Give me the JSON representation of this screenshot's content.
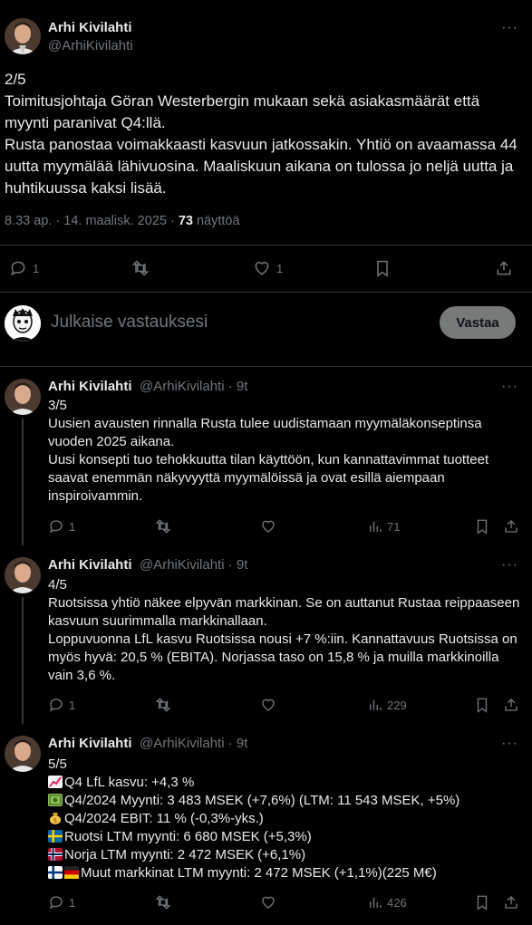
{
  "main_tweet": {
    "author": "Arhi Kivilahti",
    "handle": "@ArhiKivilahti",
    "text": "2/5\nToimitusjohtaja Göran Westerbergin mukaan sekä asiakasmäärät että myynti paranivat Q4:llä.\nRusta panostaa voimakkaasti kasvuun jatkossakin. Yhtiö on avaamassa 44 uutta myymälää lähivuosina. Maaliskuun aikana on tulossa jo neljä uutta ja huhtikuussa kaksi lisää.",
    "time": "8.33 ap. · 14. maalisk. 2025 · ",
    "views_count": "73",
    "views_label": " näyttöä",
    "replies": "1",
    "likes": "1"
  },
  "reply_box": {
    "placeholder": "Julkaise vastauksesi",
    "button": "Vastaa"
  },
  "replies": [
    {
      "author": "Arhi Kivilahti",
      "handle": "@ArhiKivilahti · 9t",
      "text": "3/5\nUusien avausten rinnalla Rusta tulee uudistamaan myymäläkonseptinsa vuoden 2025 aikana.\nUusi konsepti tuo tehokkuutta tilan käyttöön, kun kannattavimmat tuotteet saavat enemmän näkyvyyttä myymälöissä ja ovat esillä aiempaan inspiroivammin.",
      "replies": "1",
      "views": "71"
    },
    {
      "author": "Arhi Kivilahti",
      "handle": "@ArhiKivilahti · 9t",
      "text": "4/5\nRuotsissa yhtiö näkee elpyvän markkinan. Se on auttanut Rustaa reippaaseen kasvuun suurimmalla markkinallaan.\nLoppuvuonna LfL kasvu Ruotsissa nousi +7 %:iin. Kannattavuus Ruotsissa on myös hyvä: 20,5 % (EBITA). Norjassa taso on 15,8 % ja muilla markkinoilla vain 3,6 %.",
      "replies": "1",
      "views": "229"
    },
    {
      "author": "Arhi Kivilahti",
      "handle": "@ArhiKivilahti · 9t",
      "intro": "5/5",
      "lines": [
        {
          "icon": "chart-up-emoji",
          "text": "Q4 LfL kasvu: +4,3 %"
        },
        {
          "icon": "dollar-bills-emoji",
          "text": "Q4/2024 Myynti: 3 483 MSEK (+7,6%) (LTM: 11 543 MSEK, +5%)"
        },
        {
          "icon": "money-bag-emoji",
          "text": "Q4/2024 EBIT: 11 % (-0,3%-yks.)"
        },
        {
          "icon": "sweden-flag-emoji",
          "text": "Ruotsi LTM myynti: 6 680 MSEK (+5,3%)"
        },
        {
          "icon": "norway-flag-emoji",
          "text": "Norja LTM myynti: 2 472 MSEK (+6,1%)"
        },
        {
          "icon": "finland-germany-flags-emoji",
          "text": "Muut markkinat LTM myynti: 2 472 MSEK (+1,1%)(225 M€)"
        }
      ],
      "replies": "1",
      "views": "426"
    }
  ],
  "colors": {
    "background": "#000000",
    "text": "#e7e9ea",
    "muted": "#71767b",
    "divider": "#2f3336",
    "button": "#787a7a"
  }
}
